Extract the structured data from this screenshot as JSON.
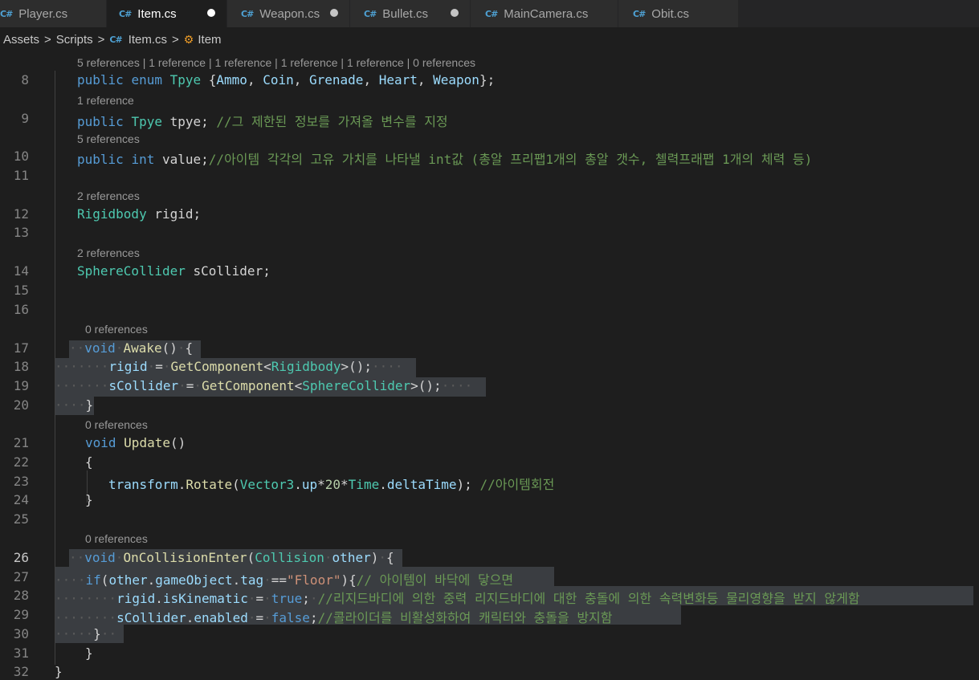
{
  "tabs": [
    {
      "label": "Player.cs",
      "dot": false,
      "active": false
    },
    {
      "label": "Item.cs",
      "dot": true,
      "active": true
    },
    {
      "label": "Weapon.cs",
      "dot": true,
      "active": false
    },
    {
      "label": "Bullet.cs",
      "dot": true,
      "active": false
    },
    {
      "label": "MainCamera.cs",
      "dot": false,
      "active": false
    },
    {
      "label": "Obit.cs",
      "dot": false,
      "active": false
    }
  ],
  "breadcrumb": {
    "assets": "Assets",
    "scripts": "Scripts",
    "file": "Item.cs",
    "symbol": "Item"
  },
  "codelens": {
    "l8": "5 references | 1 reference | 1 reference | 1 reference | 1 reference | 0 references",
    "l9": "1 reference",
    "l10": "5 references",
    "l12": "2 references",
    "l14": "2 references",
    "l17": "0 references",
    "l21": "0 references",
    "l26": "0 references"
  },
  "line_numbers": {
    "n8": "8",
    "n9": "9",
    "n10": "10",
    "n11": "11",
    "n12": "12",
    "n13": "13",
    "n14": "14",
    "n15": "15",
    "n16": "16",
    "n17": "17",
    "n18": "18",
    "n19": "19",
    "n20": "20",
    "n21": "21",
    "n22": "22",
    "n23": "23",
    "n24": "24",
    "n25": "25",
    "n26": "26",
    "n27": "27",
    "n28": "28",
    "n29": "29",
    "n30": "30",
    "n31": "31",
    "n32": "32"
  },
  "code": {
    "public": "public",
    "enum": "enum",
    "tpye_type": "Tpye",
    "enum_values": [
      "Ammo",
      "Coin",
      "Grenade",
      "Heart",
      "Weapon"
    ],
    "tpye_var": "tpye",
    "c9": "//그 제한된 정보를 가져올 변수를 지정",
    "int": "int",
    "value_var": "value",
    "c10": "//아이템 각각의 고유 가치를 나타낼 int값 (총알 프리팹1개의 총알 갯수, 첼력프래팹 1개의 체력 등)",
    "rigidbody": "Rigidbody",
    "rigid": "rigid",
    "spherecollider": "SphereCollider",
    "scollider": "sCollider",
    "void": "void",
    "awake": "Awake",
    "getcomponent": "GetComponent",
    "update": "Update",
    "transform": "transform",
    "rotate": "Rotate",
    "vector3": "Vector3",
    "up": "up",
    "twenty": "20",
    "time": "Time",
    "deltatime": "deltaTime",
    "c23": "//아이템회전",
    "oncollision": "OnCollisionEnter",
    "collision": "Collision",
    "other": "other",
    "if": "if",
    "gameobject": "gameObject",
    "tag": "tag",
    "floor": "\"Floor\"",
    "c27": "// 아이템이 바닥에 닿으면",
    "iskinematic": "isKinematic",
    "true": "true",
    "c28": "//리지드바디에 의한 중력 리지드바디에 대한 충돌에 의한 속력변화등 물리영향을 받지 않게함",
    "enabled": "enabled",
    "false": "false",
    "c29": "//콜라이더를 비활성화하여 캐릭터와 충돌을 방지함"
  },
  "colors": {
    "background": "#1e1e1e",
    "keyword": "#569cd6",
    "type": "#4ec9b0",
    "function": "#dcdcaa",
    "variable": "#9cdcfe",
    "comment": "#6a9955",
    "string": "#ce9178",
    "number": "#b5cea8",
    "selection": "#3a3d41"
  },
  "icons": {
    "tab_file": "csharp-file-icon",
    "breadcrumb_symbol": "class-icon",
    "modified": "unsaved-dot-icon"
  }
}
